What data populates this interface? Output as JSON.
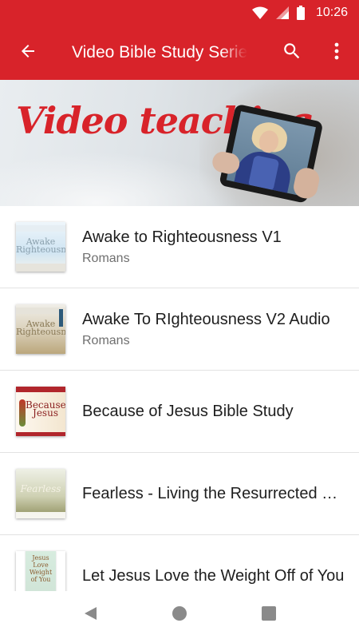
{
  "status_bar": {
    "time": "10:26",
    "icons": [
      "wifi-icon",
      "cell-signal-icon",
      "battery-icon"
    ]
  },
  "app_bar": {
    "title": "Video Bible Study Series",
    "back_icon": "arrow-back-icon",
    "search_icon": "search-icon",
    "menu_icon": "more-vert-icon",
    "color": "#d8232a"
  },
  "banner": {
    "headline": "Video teaching"
  },
  "items": [
    {
      "title": "Awake to Righteousness V1",
      "subtitle": "Romans",
      "thumb_text": "Awake Righteousness",
      "thumb_color": "#cfe4f2"
    },
    {
      "title": "Awake To RIghteousness V2 Audio",
      "subtitle": "Romans",
      "thumb_text": "Awake Righteousness",
      "thumb_color": "#d9cfb8"
    },
    {
      "title": "Because of Jesus Bible Study",
      "subtitle": "",
      "thumb_text": "Because Jesus",
      "thumb_color": "#f3e6cf"
    },
    {
      "title": "Fearless - Living the Resurrected Life",
      "subtitle": "",
      "thumb_text": "Fearless",
      "thumb_color": "#c9c9a8"
    },
    {
      "title": "Let Jesus Love the Weight Off of You",
      "subtitle": "",
      "thumb_text": "Jesus Love Weight of You",
      "thumb_color": "#cfe3d6"
    }
  ],
  "nav_bar": {
    "icons": [
      "back-triangle-icon",
      "home-circle-icon",
      "recents-square-icon"
    ]
  }
}
